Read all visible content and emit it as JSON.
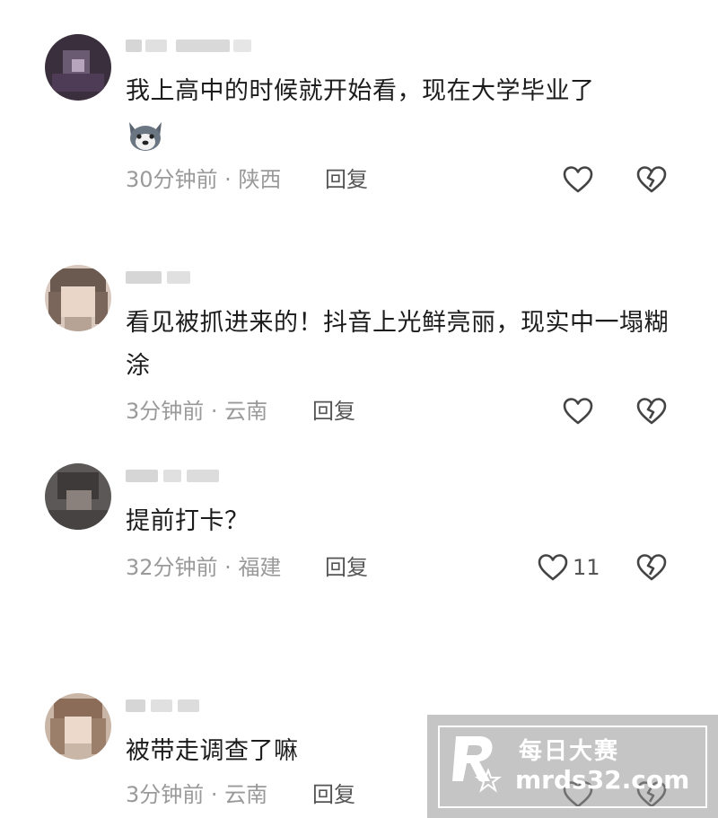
{
  "comments": [
    {
      "text": "我上高中的时候就开始看，现在大学毕业了",
      "has_emoji": true,
      "emoji_name": "husky-dog-emoji",
      "time": "30分钟前",
      "location": "陕西",
      "reply_label": "回复",
      "like_count": ""
    },
    {
      "text": "看见被抓进来的！抖音上光鲜亮丽，现实中一塌糊涂",
      "has_emoji": false,
      "time": "3分钟前",
      "location": "云南",
      "reply_label": "回复",
      "like_count": ""
    },
    {
      "text": "提前打卡？",
      "has_emoji": false,
      "time": "32分钟前",
      "location": "福建",
      "reply_label": "回复",
      "like_count": "11"
    },
    {
      "text": "被带走调查了嘛",
      "has_emoji": false,
      "time": "3分钟前",
      "location": "云南",
      "reply_label": "回复",
      "like_count": ""
    }
  ],
  "meta_separator": " · ",
  "watermark": {
    "title": "每日大赛",
    "url": "mrds32.com"
  },
  "colors": {
    "meta": "#9a9a9a",
    "text": "#1c1c1c",
    "icon": "#444444"
  }
}
